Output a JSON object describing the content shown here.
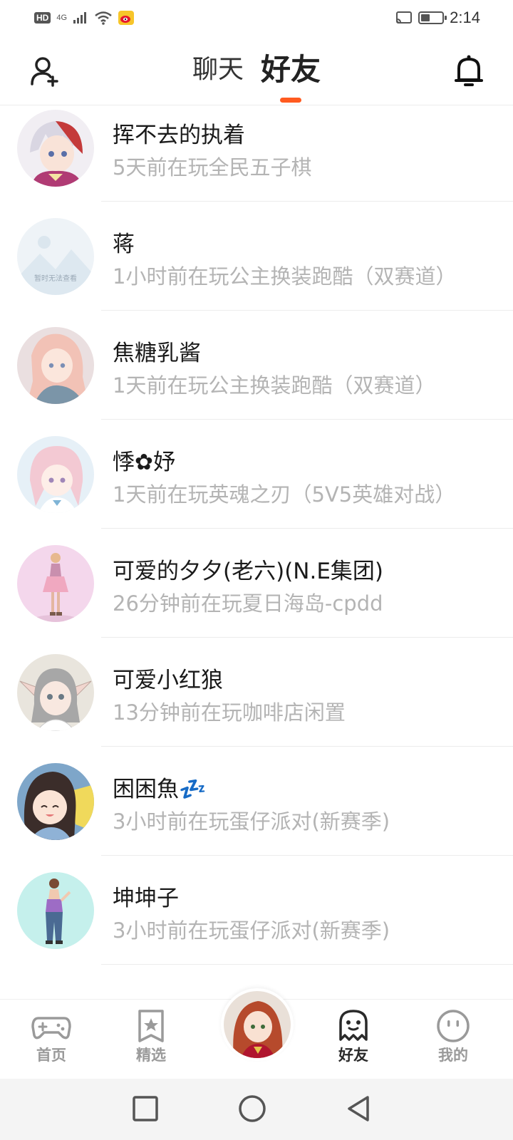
{
  "status_bar": {
    "left_badge": "HD",
    "network": "4G",
    "time": "2:14",
    "battery_level": 0.4
  },
  "header": {
    "tabs": [
      {
        "label": "聊天",
        "active": false
      },
      {
        "label": "好友",
        "active": true
      }
    ],
    "left_icon": "add-friend-icon",
    "right_icon": "bell-icon",
    "accent_color": "#ff5a1f"
  },
  "friends": [
    {
      "name": "挥不去的执着",
      "status": "5天前在玩全民五子棋"
    },
    {
      "name": "蒋",
      "status": "1小时前在玩公主换装跑酷（双赛道）",
      "avatar_text": "暂时无法查看"
    },
    {
      "name": "焦糖乳酱",
      "status": "1天前在玩公主换装跑酷（双赛道）"
    },
    {
      "name": "悸✿妤",
      "status": "1天前在玩英魂之刃（5V5英雄对战）"
    },
    {
      "name": "可爱的夕夕(老六)(N.E集团)",
      "status": "26分钟前在玩夏日海岛-cpdd"
    },
    {
      "name": "可爱小红狼",
      "status": "13分钟前在玩咖啡店闲置"
    },
    {
      "name": "困困魚💤",
      "status": "3小时前在玩蛋仔派对(新赛季)"
    },
    {
      "name": "坤坤子",
      "status": "3小时前在玩蛋仔派对(新赛季)"
    }
  ],
  "bottom_nav": {
    "items": [
      {
        "label": "首页",
        "icon": "gamepad-icon",
        "active": false
      },
      {
        "label": "精选",
        "icon": "star-bookmark-icon",
        "active": false
      },
      {
        "label": "好友",
        "icon": "ghost-icon",
        "active": true
      },
      {
        "label": "我的",
        "icon": "smiley-icon",
        "active": false
      }
    ],
    "center_icon": "profile-avatar"
  },
  "system_nav": {
    "icons": [
      "recent-apps-icon",
      "home-icon",
      "back-icon"
    ]
  }
}
